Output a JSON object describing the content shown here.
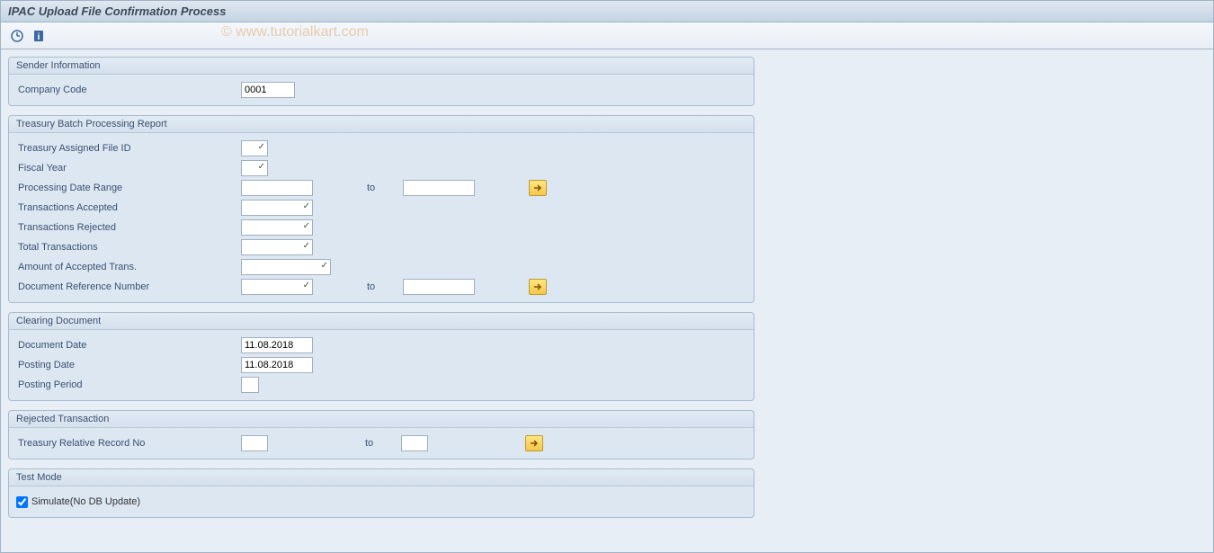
{
  "title": "IPAC Upload File Confirmation Process",
  "watermark": "© www.tutorialkart.com",
  "toolbar": {
    "execute": "execute",
    "info": "info"
  },
  "groups": {
    "sender": {
      "title": "Sender Information",
      "company_code_label": "Company Code",
      "company_code_value": "0001"
    },
    "treasury": {
      "title": "Treasury Batch Processing Report",
      "file_id_label": "Treasury Assigned File ID",
      "fiscal_year_label": "Fiscal Year",
      "proc_date_label": "Processing Date Range",
      "to_label": "to",
      "trans_accepted_label": "Transactions Accepted",
      "trans_rejected_label": "Transactions Rejected",
      "total_trans_label": "Total Transactions",
      "amount_accepted_label": "Amount of Accepted Trans.",
      "doc_ref_label": "Document Reference Number"
    },
    "clearing": {
      "title": "Clearing Document",
      "doc_date_label": "Document Date",
      "doc_date_value": "11.08.2018",
      "post_date_label": "Posting Date",
      "post_date_value": "11.08.2018",
      "post_period_label": "Posting Period"
    },
    "rejected": {
      "title": "Rejected Transaction",
      "rel_record_label": "Treasury Relative Record  No",
      "to_label": "to"
    },
    "test": {
      "title": "Test Mode",
      "simulate_label": "Simulate(No DB Update)"
    }
  }
}
